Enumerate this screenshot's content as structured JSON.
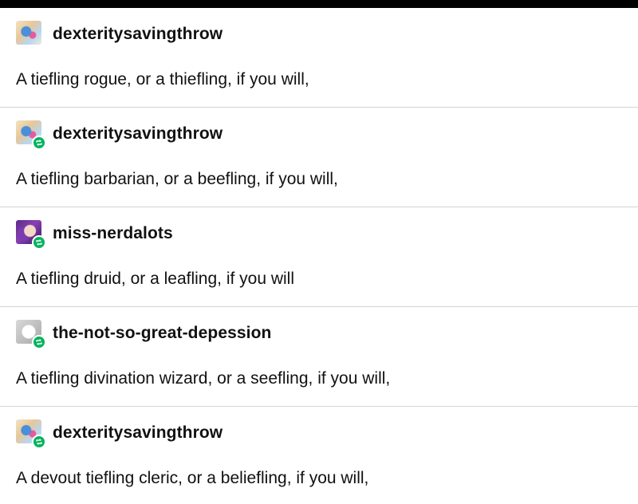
{
  "colors": {
    "background": "#ffffff",
    "text": "#111111",
    "divider": "#d4d4d4",
    "reblog_badge": "#00b35c",
    "top_bar": "#000000"
  },
  "thread": {
    "posts": [
      {
        "username": "dexteritysavingthrow",
        "avatar_icon": "avatar-dexteritysavingthrow",
        "reblog_badge": false,
        "text": "A tiefling rogue, or a thiefling, if you will,"
      },
      {
        "username": "dexteritysavingthrow",
        "avatar_icon": "avatar-dexteritysavingthrow",
        "reblog_badge": true,
        "text": "A tiefling barbarian, or a beefling, if you will,"
      },
      {
        "username": "miss-nerdalots",
        "avatar_icon": "avatar-miss-nerdalots",
        "reblog_badge": true,
        "text": "A tiefling druid, or a leafling, if you will"
      },
      {
        "username": "the-not-so-great-depession",
        "avatar_icon": "avatar-the-not-so-great-depession",
        "reblog_badge": true,
        "text": "A tiefling divination wizard, or a seefling, if you will,"
      },
      {
        "username": "dexteritysavingthrow",
        "avatar_icon": "avatar-dexteritysavingthrow",
        "reblog_badge": true,
        "text": "A devout tiefling cleric, or a beliefling, if you will,"
      }
    ]
  }
}
